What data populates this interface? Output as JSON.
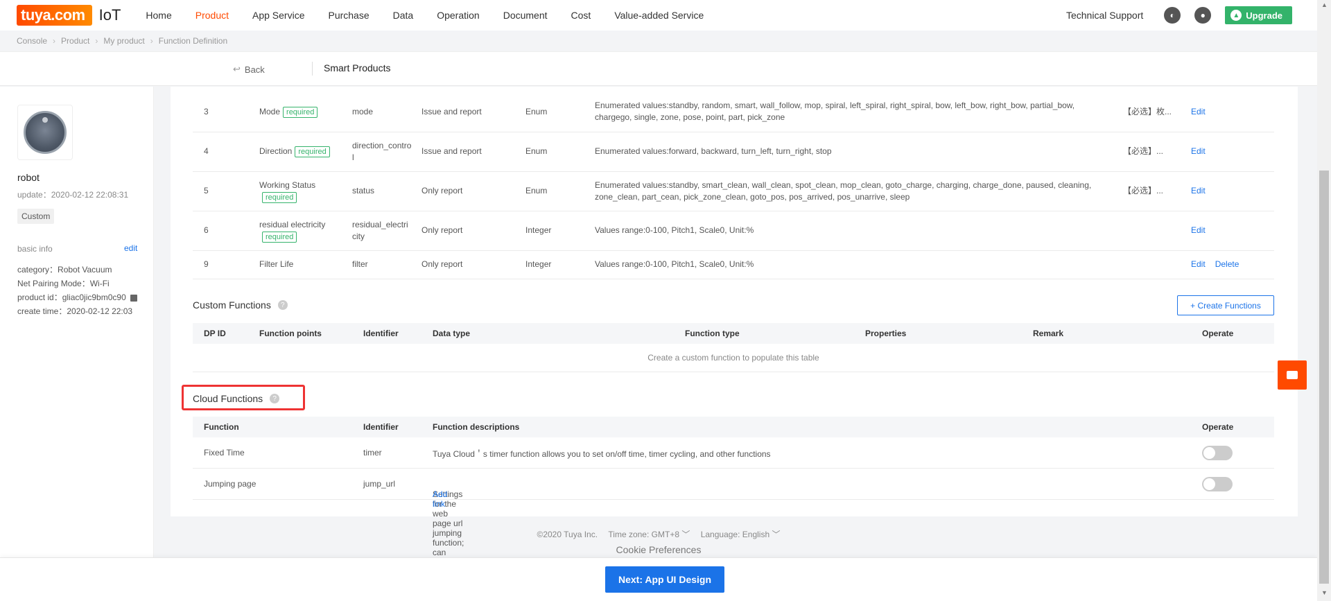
{
  "nav": {
    "logo_text": "tuya.com",
    "iot": "IoT",
    "items": [
      "Home",
      "Product",
      "App Service",
      "Purchase",
      "Data",
      "Operation",
      "Document",
      "Cost",
      "Value-added Service"
    ],
    "technical_support": "Technical Support",
    "upgrade": "Upgrade"
  },
  "breadcrumb": [
    "Console",
    "Product",
    "My product",
    "Function Definition"
  ],
  "subbar": {
    "back": "Back",
    "title": "Smart Products"
  },
  "sidebar": {
    "name": "robot",
    "update": "update：2020-02-12 22:08:31",
    "tag": "Custom",
    "basic_info": "basic info",
    "edit": "edit",
    "category": "category：Robot Vacuum",
    "pairing": "Net Pairing Mode：Wi-Fi",
    "product_id": "product id：gliac0jic9bm0c90",
    "create_time": "create time：2020-02-12 22:03"
  },
  "standard_rows": [
    {
      "id": "3",
      "name": "Mode",
      "required": "required",
      "identifier": "mode",
      "transfer": "Issue and report",
      "type": "Enum",
      "props": "Enumerated values:standby, random, smart, wall_follow, mop, spiral, left_spiral, right_spiral, bow, left_bow, right_bow, partial_bow, chargego, single, zone, pose, point, part, pick_zone",
      "remark": "【必选】枚...",
      "edit": "Edit",
      "delete": ""
    },
    {
      "id": "4",
      "name": "Direction",
      "required": "required",
      "identifier": "direction_control",
      "transfer": "Issue and report",
      "type": "Enum",
      "props": "Enumerated values:forward, backward, turn_left, turn_right, stop",
      "remark": "【必选】...",
      "edit": "Edit",
      "delete": ""
    },
    {
      "id": "5",
      "name": "Working Status",
      "required": "required",
      "identifier": "status",
      "transfer": "Only report",
      "type": "Enum",
      "props": "Enumerated values:standby, smart_clean, wall_clean, spot_clean, mop_clean, goto_charge, charging, charge_done, paused, cleaning, zone_clean, part_cean, pick_zone_clean, goto_pos, pos_arrived, pos_unarrive, sleep",
      "remark": "【必选】...",
      "edit": "Edit",
      "delete": ""
    },
    {
      "id": "6",
      "name": "residual electricity",
      "required": "required",
      "identifier": "residual_electricity",
      "transfer": "Only report",
      "type": "Integer",
      "props": "Values range:0-100, Pitch1, Scale0, Unit:%",
      "remark": "",
      "edit": "Edit",
      "delete": ""
    },
    {
      "id": "9",
      "name": "Filter Life",
      "required": "",
      "identifier": "filter",
      "transfer": "Only report",
      "type": "Integer",
      "props": "Values range:0-100, Pitch1, Scale0, Unit:%",
      "remark": "",
      "edit": "Edit",
      "delete": "Delete"
    }
  ],
  "custom": {
    "title": "Custom Functions",
    "create_btn": "+ Create Functions",
    "headers": [
      "DP ID",
      "Function points",
      "Identifier",
      "Data type",
      "Function type",
      "Properties",
      "Remark",
      "Operate"
    ],
    "empty": "Create a custom function to populate this table"
  },
  "cloud": {
    "title": "Cloud Functions",
    "headers": [
      "Function",
      "Identifier",
      "Function descriptions",
      "Operate"
    ],
    "rows": [
      {
        "name": "Fixed Time",
        "identifier": "timer",
        "desc": "Tuya Cloud＇s timer function allows you to set on/off time, timer cycling, and other functions",
        "link": ""
      },
      {
        "name": "Jumping page",
        "identifier": "jump_url",
        "desc": "Settings for the web page url jumping function; can jump to mall, official website, or other pages.",
        "link": "Add link"
      }
    ]
  },
  "footer": {
    "copyright": "©2020 Tuya Inc.",
    "timezone_label": "Time zone:",
    "timezone": "GMT+8",
    "language_label": "Language:",
    "language": "English",
    "cookie": "Cookie Preferences"
  },
  "next_button": "Next:  App UI Design"
}
